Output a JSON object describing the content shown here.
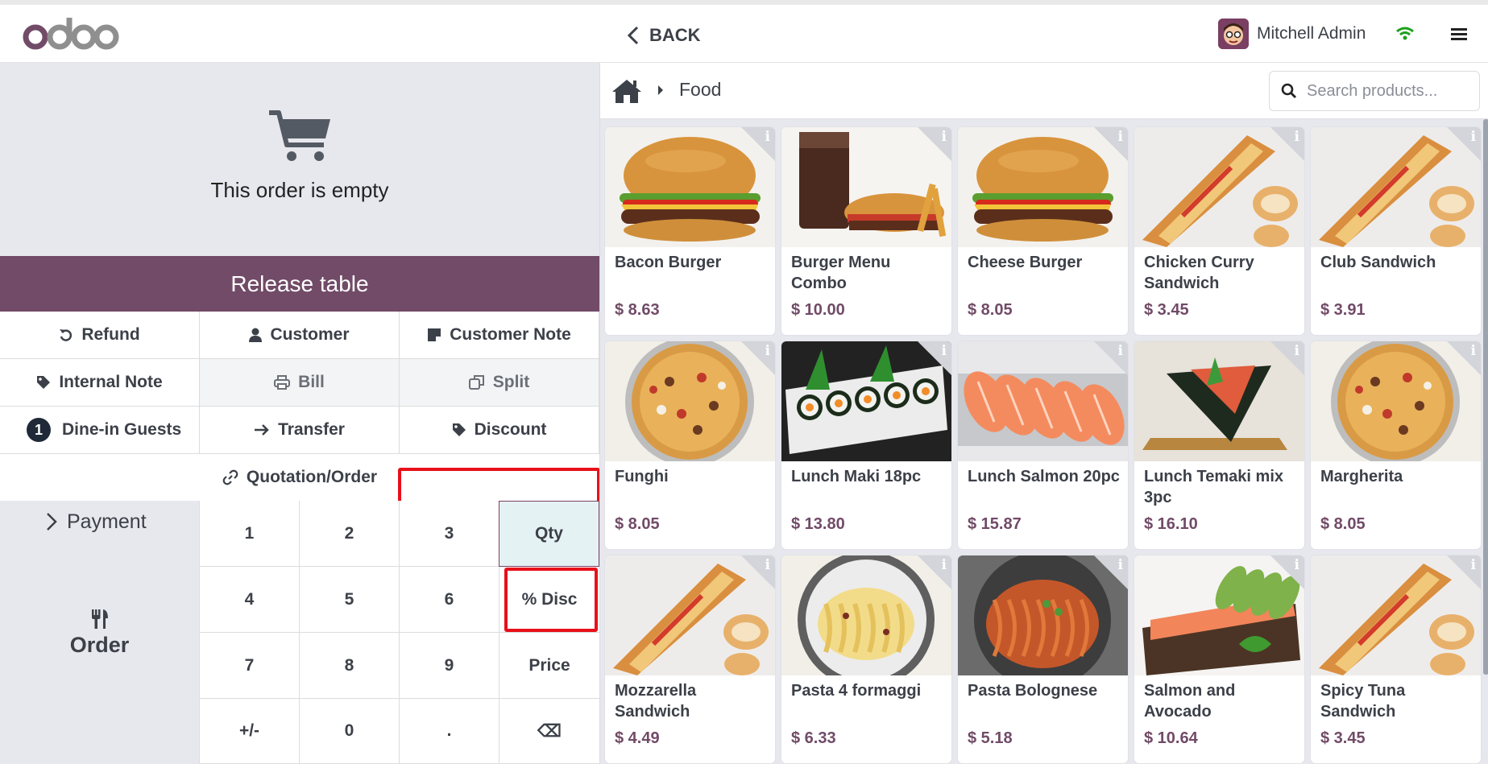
{
  "topbar": {
    "logo_text": "odoo",
    "back_label": "BACK",
    "user_name": "Mitchell Admin"
  },
  "order": {
    "empty_text": "This order is empty",
    "release_label": "Release table"
  },
  "controls": {
    "refund": "Refund",
    "customer": "Customer",
    "customer_note": "Customer Note",
    "internal_note": "Internal Note",
    "bill": "Bill",
    "split": "Split",
    "guests_count": "1",
    "guests": "Dine-in Guests",
    "transfer": "Transfer",
    "discount": "Discount",
    "quotation": "Quotation/Order"
  },
  "actions": {
    "payment": "Payment",
    "order": "Order"
  },
  "numpad": {
    "keys": [
      "1",
      "2",
      "3",
      "Qty",
      "4",
      "5",
      "6",
      "% Disc",
      "7",
      "8",
      "9",
      "Price",
      "+/-",
      "0",
      ".",
      "⌫"
    ]
  },
  "breadcrumb": {
    "current": "Food"
  },
  "search": {
    "placeholder": "Search products..."
  },
  "products": [
    {
      "name": "Bacon Burger",
      "price": "$ 8.63",
      "kind": "burger"
    },
    {
      "name": "Burger Menu Combo",
      "price": "$ 10.00",
      "kind": "combo"
    },
    {
      "name": "Cheese Burger",
      "price": "$ 8.05",
      "kind": "burger"
    },
    {
      "name": "Chicken Curry Sandwich",
      "price": "$ 3.45",
      "kind": "sandwich"
    },
    {
      "name": "Club Sandwich",
      "price": "$ 3.91",
      "kind": "sandwich"
    },
    {
      "name": "Funghi",
      "price": "$ 8.05",
      "kind": "pizza"
    },
    {
      "name": "Lunch Maki 18pc",
      "price": "$ 13.80",
      "kind": "maki"
    },
    {
      "name": "Lunch Salmon 20pc",
      "price": "$ 15.87",
      "kind": "salmon"
    },
    {
      "name": "Lunch Temaki mix 3pc",
      "price": "$ 16.10",
      "kind": "temaki"
    },
    {
      "name": "Margherita",
      "price": "$ 8.05",
      "kind": "pizza"
    },
    {
      "name": "Mozzarella Sandwich",
      "price": "$ 4.49",
      "kind": "sandwich"
    },
    {
      "name": "Pasta 4 formaggi",
      "price": "$ 6.33",
      "kind": "pasta"
    },
    {
      "name": "Pasta Bolognese",
      "price": "$ 5.18",
      "kind": "bolognese"
    },
    {
      "name": "Salmon and Avocado",
      "price": "$ 10.64",
      "kind": "avocado"
    },
    {
      "name": "Spicy Tuna Sandwich",
      "price": "$ 3.45",
      "kind": "sandwich"
    }
  ],
  "colors": {
    "brand": "#714b67",
    "highlight": "#e8101a",
    "wifi": "#1aa11a"
  }
}
